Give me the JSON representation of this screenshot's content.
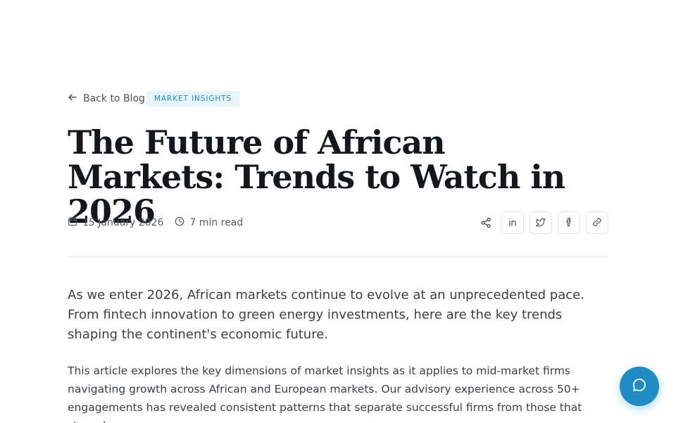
{
  "nav": {
    "back_label": "Back to Blog"
  },
  "article": {
    "category": "MARKET INSIGHTS",
    "title": "The Future of African Markets: Trends to Watch in 2026",
    "date": "15 January 2026",
    "read_time": "7 min read",
    "lead": "As we enter 2026, African markets continue to evolve at an unprecedented pace. From fintech innovation to green energy investments, here are the key trends shaping the continent's economic future.",
    "body": "This article explores the key dimensions of market insights as it applies to mid-market firms navigating growth across African and European markets. Our advisory experience across 50+ engagements has revealed consistent patterns that separate successful firms from those that struggle."
  },
  "share": {
    "icons": [
      "share-icon",
      "linkedin-icon",
      "twitter-icon",
      "facebook-icon",
      "link-icon"
    ]
  },
  "colors": {
    "accent": "#1f8cc4",
    "badge_bg": "#e8f4fb",
    "text": "#14171b"
  }
}
